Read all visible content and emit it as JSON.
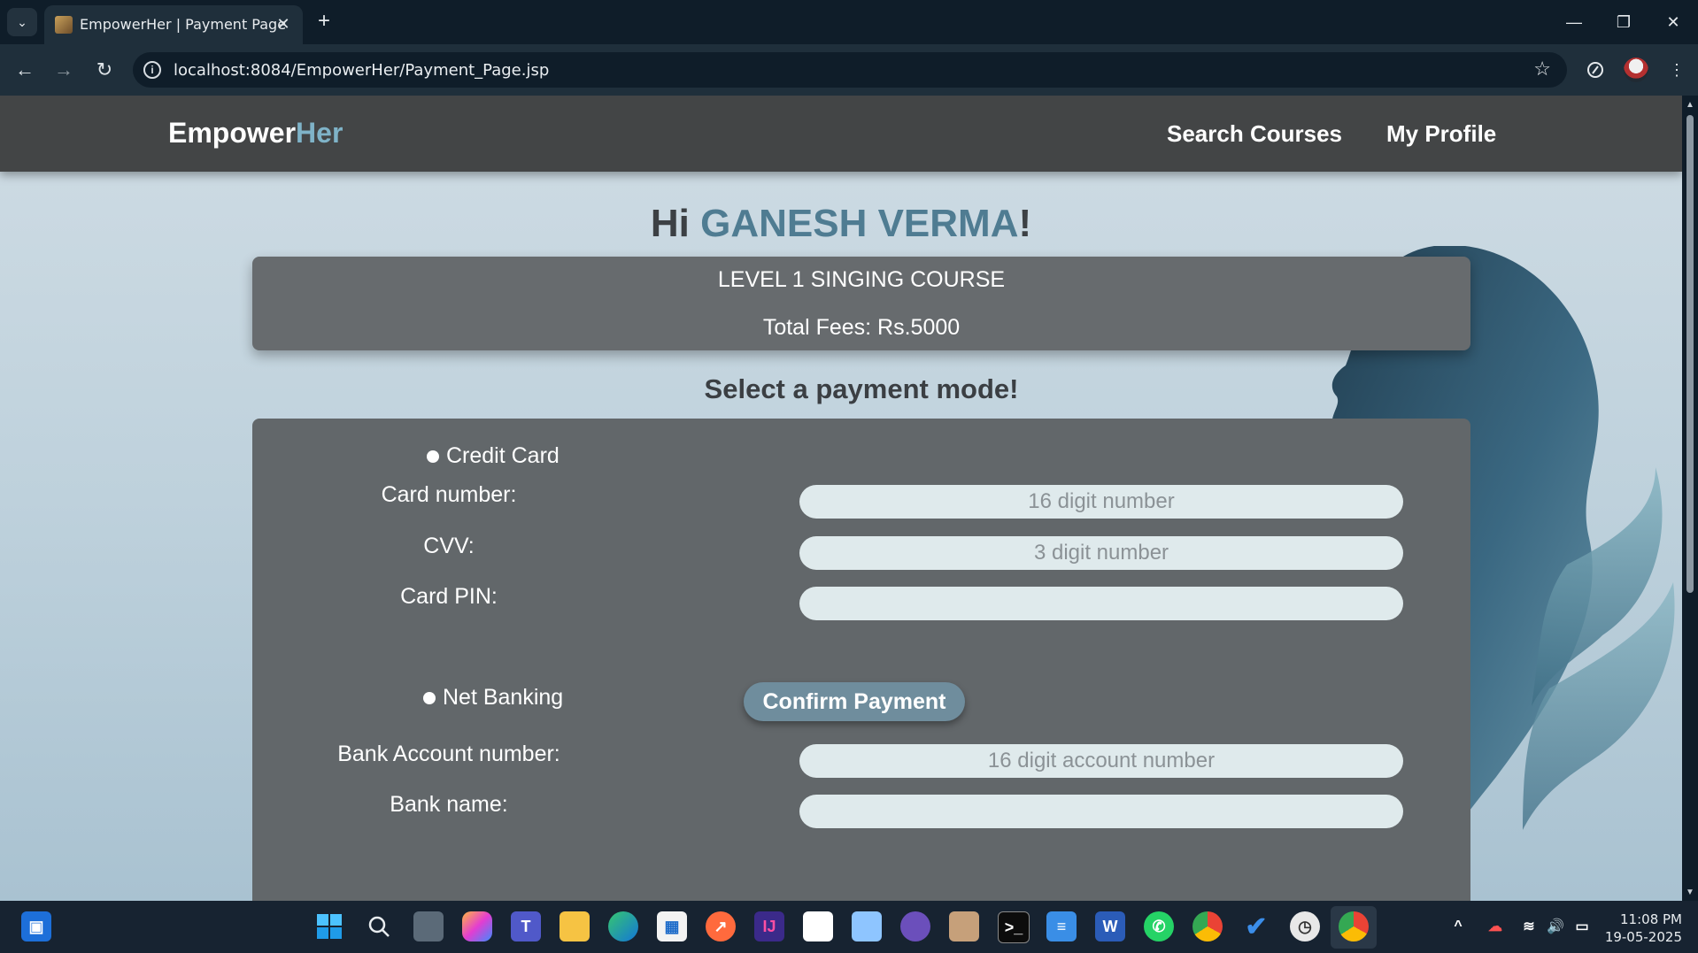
{
  "browser": {
    "tab_title": "EmpowerHer | Payment Page",
    "url": "localhost:8084/EmpowerHer/Payment_Page.jsp",
    "tab_close_glyph": "✕",
    "new_tab_glyph": "+",
    "minimize_glyph": "—",
    "restore_glyph": "❐",
    "close_glyph": "✕",
    "back_glyph": "←",
    "forward_glyph": "→",
    "reload_glyph": "↻",
    "star_glyph": "☆"
  },
  "site": {
    "brand_main": "Empower",
    "brand_accent": "Her",
    "nav": {
      "search_courses": "Search Courses",
      "my_profile": "My Profile"
    }
  },
  "greeting": {
    "prefix": "Hi ",
    "name": "GANESH VERMA",
    "suffix": "!"
  },
  "course": {
    "title": "LEVEL 1 SINGING COURSE",
    "fees": "Total Fees: Rs.5000"
  },
  "payment": {
    "heading": "Select a payment mode!",
    "credit_card": {
      "option_label": "Credit Card",
      "card_number_label": "Card number:",
      "card_number_placeholder": "16 digit number",
      "cvv_label": "CVV:",
      "cvv_placeholder": "3 digit number",
      "pin_label": "Card PIN:",
      "pin_placeholder": ""
    },
    "confirm_label": "Confirm Payment",
    "net_banking": {
      "option_label": "Net Banking",
      "account_label": "Bank Account number:",
      "account_placeholder": "16 digit account number",
      "bank_name_label": "Bank name:",
      "bank_name_placeholder": ""
    }
  },
  "taskbar": {
    "time": "11:08 PM",
    "date": "19-05-2025"
  },
  "colors": {
    "brand_accent": "#7fb3c8",
    "header_bg": "#434546",
    "panel_bg": "#62676a",
    "confirm_button": "#6f8d9d"
  }
}
